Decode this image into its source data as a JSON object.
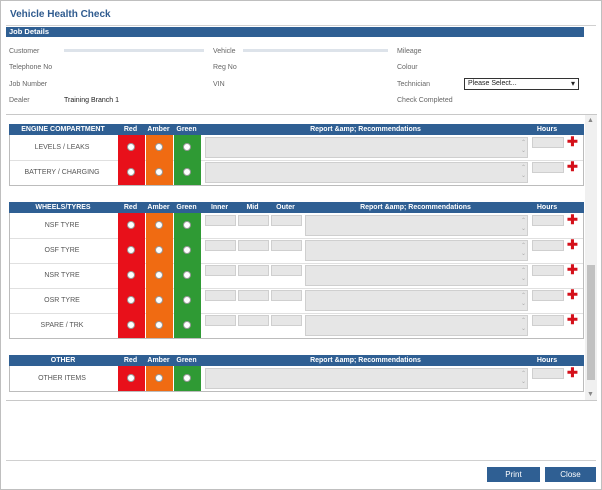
{
  "window": {
    "title": "Vehicle Health Check"
  },
  "job_details": {
    "header": "Job Details",
    "customer_label": "Customer",
    "telephone_label": "Telephone No",
    "job_number_label": "Job Number",
    "dealer_label": "Dealer",
    "dealer_value": "Training Branch 1",
    "vehicle_label": "Vehicle",
    "reg_label": "Reg No",
    "vin_label": "VIN",
    "mileage_label": "Mileage",
    "colour_label": "Colour",
    "technician_label": "Technician",
    "technician_value": "Please Select...",
    "check_completed_label": "Check Completed"
  },
  "columns": {
    "red": "Red",
    "amber": "Amber",
    "green": "Green",
    "report": "Report &amp; Recommendations",
    "hours": "Hours",
    "inner": "Inner",
    "mid": "Mid",
    "outer": "Outer"
  },
  "sections": {
    "engine": {
      "title": "ENGINE COMPARTMENT",
      "items": [
        "LEVELS / LEAKS",
        "BATTERY / CHARGING"
      ]
    },
    "tyres": {
      "title": "WHEELS/TYRES",
      "items": [
        "NSF TYRE",
        "OSF TYRE",
        "NSR TYRE",
        "OSR TYRE",
        "SPARE / TRK"
      ]
    },
    "other": {
      "title": "OTHER",
      "items": [
        "OTHER ITEMS"
      ]
    }
  },
  "colors": {
    "red": "#e8101a",
    "amber": "#f06b12",
    "green": "#2f9a34",
    "header": "#2f5f93"
  },
  "buttons": {
    "print": "Print",
    "close": "Close"
  }
}
